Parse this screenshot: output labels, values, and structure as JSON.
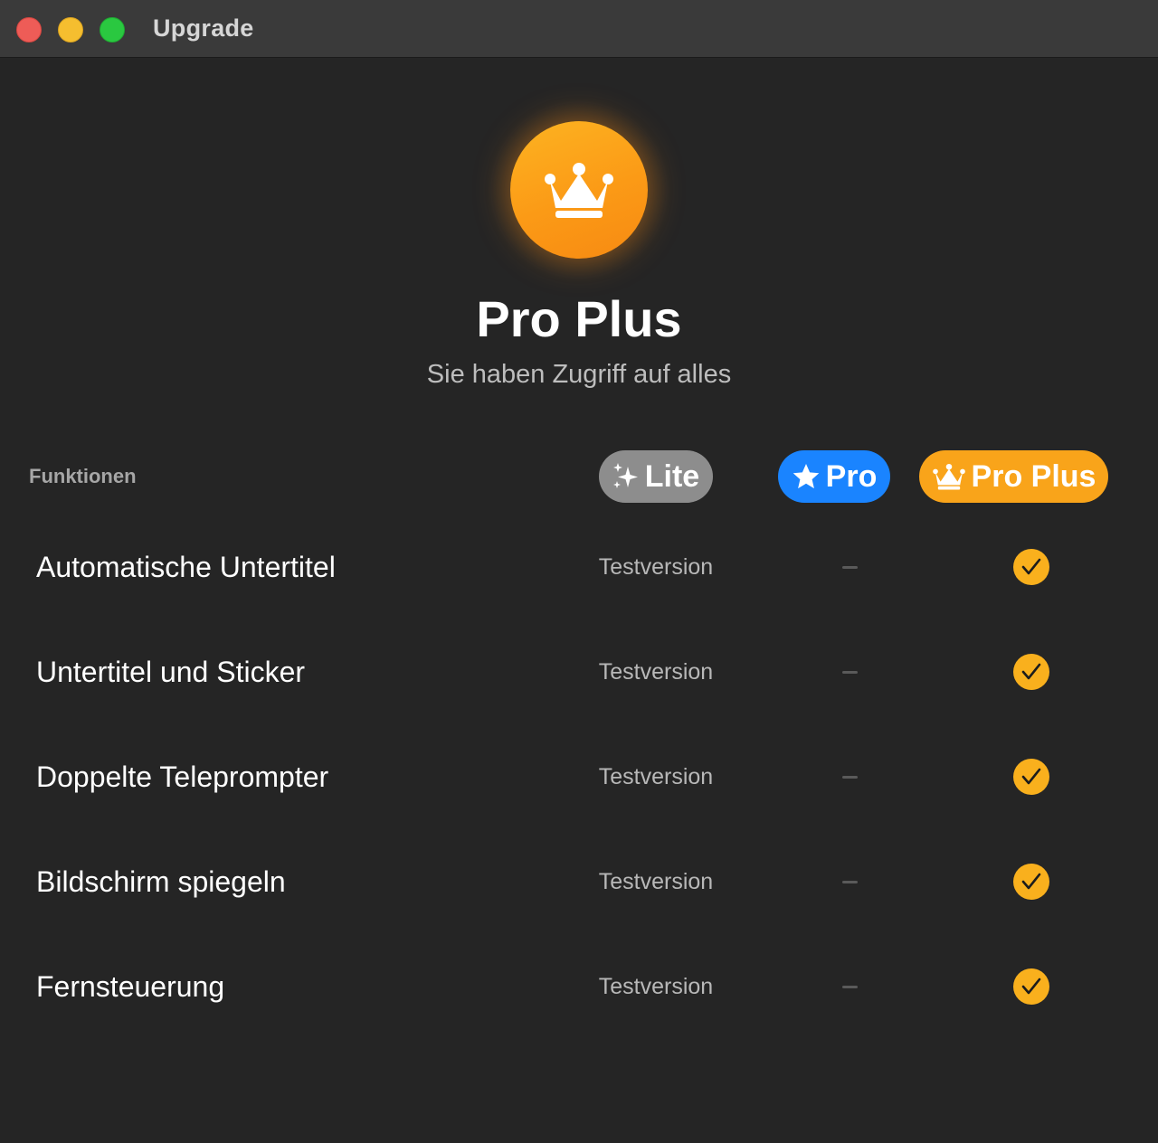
{
  "window": {
    "title": "Upgrade",
    "traffic_lights": [
      "close",
      "minimize",
      "zoom"
    ]
  },
  "hero": {
    "icon": "crown-icon",
    "title": "Pro Plus",
    "subtitle": "Sie haben Zugriff auf alles"
  },
  "table": {
    "header_label": "Funktionen",
    "plans": [
      {
        "label": "Lite",
        "icon": "sparkles-icon",
        "color": "#8d8d8d"
      },
      {
        "label": "Pro",
        "icon": "star-icon",
        "color": "#1a84ff"
      },
      {
        "label": "Pro Plus",
        "icon": "crown-icon",
        "color": "#f9a41a"
      }
    ],
    "rows": [
      {
        "feature": "Automatische Untertitel",
        "lite": "Testversion",
        "pro": "dash",
        "pro_plus": "check"
      },
      {
        "feature": "Untertitel und Sticker",
        "lite": "Testversion",
        "pro": "dash",
        "pro_plus": "check"
      },
      {
        "feature": "Doppelte Teleprompter",
        "lite": "Testversion",
        "pro": "dash",
        "pro_plus": "check"
      },
      {
        "feature": "Bildschirm spiegeln",
        "lite": "Testversion",
        "pro": "dash",
        "pro_plus": "check"
      },
      {
        "feature": "Fernsteuerung",
        "lite": "Testversion",
        "pro": "dash",
        "pro_plus": "check"
      }
    ]
  },
  "colors": {
    "background": "#252525",
    "titlebar": "#3a3a3a",
    "accent_orange": "#f9a41a",
    "accent_blue": "#1a84ff"
  }
}
